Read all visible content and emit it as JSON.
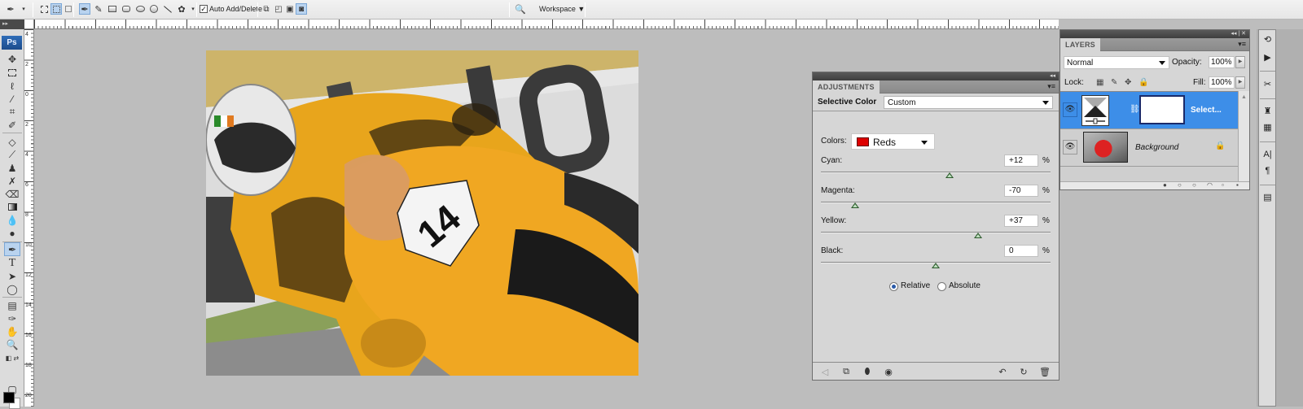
{
  "app": {
    "logo": "Ps"
  },
  "options_bar": {
    "tool_preset_icon": "pen-tool-icon",
    "path_modes": [
      "shape-layers-icon",
      "paths-icon",
      "fill-pixels-icon"
    ],
    "shape_tools": [
      "pen-icon",
      "freeform-pen-icon",
      "rectangle-icon",
      "rounded-rectangle-icon",
      "ellipse-icon",
      "polygon-icon",
      "line-icon",
      "custom-shape-icon"
    ],
    "auto_add_delete": {
      "label": "Auto Add/Delete",
      "checked": true
    },
    "path_ops": [
      "combine-icon",
      "subtract-icon",
      "intersect-icon",
      "exclude-icon"
    ],
    "workspace_label": "Workspace ▼",
    "workspace_icon": "workspace-zoom-icon"
  },
  "rulers": {
    "left_numbers": [
      "4",
      "2",
      "0",
      "2",
      "4",
      "6",
      "8",
      "10",
      "12",
      "14",
      "16",
      "18",
      "20"
    ]
  },
  "tools": [
    "move-tool",
    "marquee-tool",
    "lasso-tool",
    "magic-wand-tool",
    "crop-tool",
    "eyedropper-slice-tool",
    "healing-tool",
    "brush-tool",
    "clone-stamp-tool",
    "history-brush-tool",
    "eraser-tool",
    "gradient-tool",
    "blur-tool",
    "dodge-tool",
    "pen-tool",
    "type-tool",
    "path-selection-tool",
    "shape-tool",
    "notes-tool",
    "eyedropper-tool",
    "hand-tool",
    "zoom-tool"
  ],
  "tools_active": "pen-tool",
  "colors": {
    "foreground": "#000000",
    "background": "#ffffff"
  },
  "canvas": {
    "image_description": "Motorcycle racer #14 leaning into a turn, yellow-tinted",
    "number_plate": "14"
  },
  "adjustments": {
    "tab": "ADJUSTMENTS",
    "type_label": "Selective Color",
    "preset": "Custom",
    "colors_label": "Colors:",
    "colors_value": "Reds",
    "colors_swatch": "#dd0000",
    "sliders": [
      {
        "label": "Cyan:",
        "value": "+12",
        "numeric": 12,
        "unit": "%"
      },
      {
        "label": "Magenta:",
        "value": "-70",
        "numeric": -70,
        "unit": "%"
      },
      {
        "label": "Yellow:",
        "value": "+37",
        "numeric": 37,
        "unit": "%"
      },
      {
        "label": "Black:",
        "value": "0",
        "numeric": 0,
        "unit": "%"
      }
    ],
    "method": {
      "relative_label": "Relative",
      "absolute_label": "Absolute",
      "selected": "Relative"
    },
    "footer_icons": [
      "return-to-list-icon",
      "clip-to-layer-icon",
      "toggle-visibility-icon",
      "view-previous-state-icon",
      "reset-icon",
      "delete-icon"
    ]
  },
  "layers": {
    "tab": "LAYERS",
    "blend_mode": "Normal",
    "opacity_label": "Opacity:",
    "opacity": "100%",
    "lock_label": "Lock:",
    "fill_label": "Fill:",
    "fill": "100%",
    "items": [
      {
        "name": "Select...",
        "type": "adjustment",
        "selected": true,
        "visible": true
      },
      {
        "name": "Background",
        "type": "image",
        "selected": false,
        "visible": true,
        "locked": true
      }
    ],
    "footer_icons": [
      "link-layers-icon",
      "fx-icon",
      "mask-icon",
      "adjustment-layer-icon",
      "group-icon",
      "new-layer-icon",
      "delete-layer-icon"
    ]
  },
  "dock": {
    "icons": [
      "history-icon",
      "actions-icon",
      "tools-presets-icon",
      "clone-source-icon",
      "brushes-icon",
      "character-icon",
      "paragraph-icon",
      "layer-comps-icon"
    ]
  }
}
